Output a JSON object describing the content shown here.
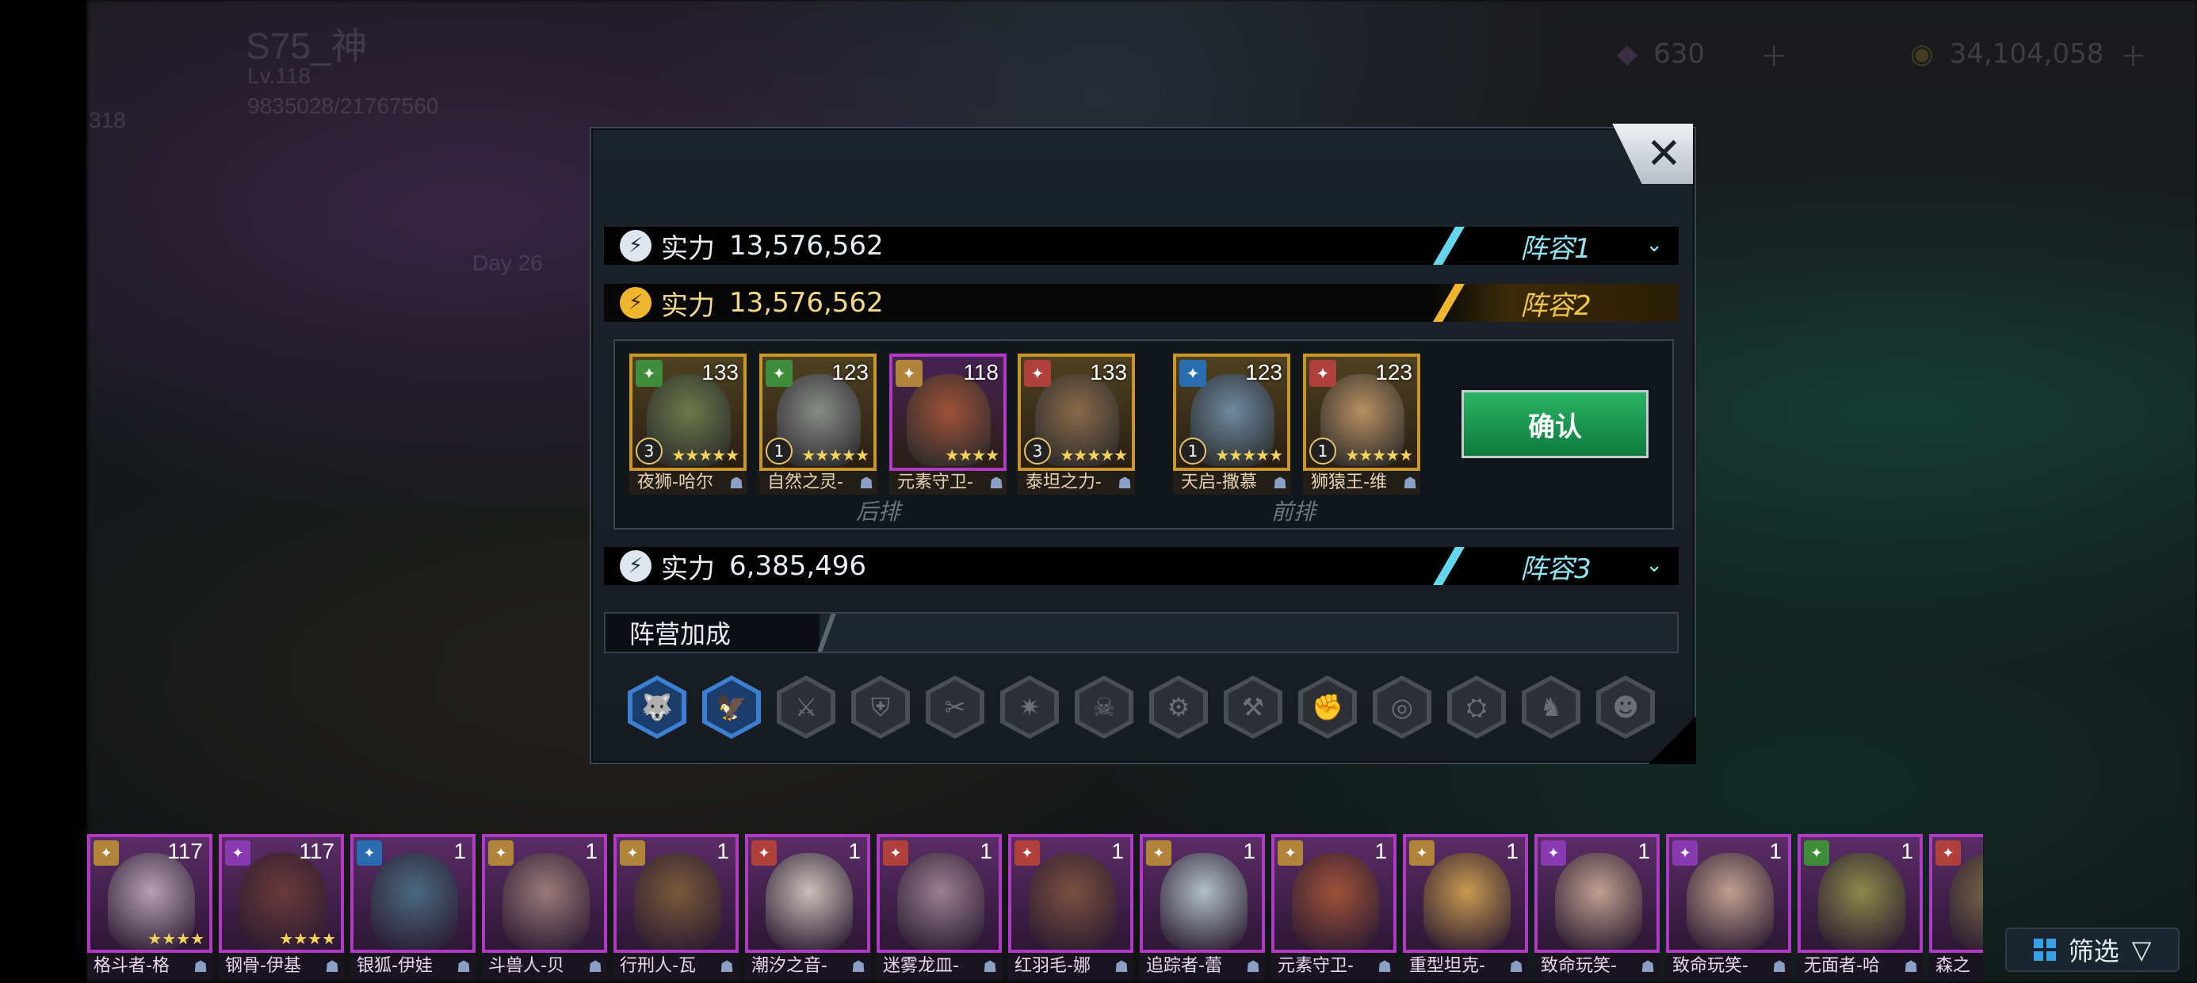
{
  "background": {
    "player_name": "S75_神",
    "level": "Lv.118",
    "exp": "9835028/21767560",
    "vip": "318",
    "day": "Day 26",
    "gems": "630",
    "gold": "34,104,058"
  },
  "dialog": {
    "close_label": "✕",
    "lineups": [
      {
        "power_label": "实力",
        "power": "13,576,562",
        "tag": "阵容1",
        "active": false
      },
      {
        "power_label": "实力",
        "power": "13,576,562",
        "tag": "阵容2",
        "active": true
      },
      {
        "power_label": "实力",
        "power": "6,385,496",
        "tag": "阵容3",
        "active": false
      }
    ],
    "confirm_label": "确认",
    "back_row_label": "后排",
    "front_row_label": "前排",
    "heroes": [
      {
        "name": "夜狮-哈尔",
        "level": "133",
        "badge": "3",
        "stars": "★★★★★",
        "faction_color": "#3f8c3a",
        "border": "#c8962a",
        "face": "#6e7a4a"
      },
      {
        "name": "自然之灵-",
        "level": "123",
        "badge": "1",
        "stars": "★★★★★",
        "faction_color": "#3f8c3a",
        "border": "#c8962a",
        "face": "#8a8c8a"
      },
      {
        "name": "元素守卫-",
        "level": "118",
        "badge": "",
        "stars": "★★★★",
        "faction_color": "#b0843b",
        "border": "#b03ac4",
        "face": "#a0523a"
      },
      {
        "name": "泰坦之力-",
        "level": "133",
        "badge": "3",
        "stars": "★★★★★",
        "faction_color": "#b0403b",
        "border": "#c8962a",
        "face": "#8a6a4a"
      },
      {
        "name": "天启-撒慕",
        "level": "123",
        "badge": "1",
        "stars": "★★★★★",
        "faction_color": "#2a6cb0",
        "border": "#c8962a",
        "face": "#6e8aa0"
      },
      {
        "name": "狮猿王-维",
        "level": "123",
        "badge": "1",
        "stars": "★★★★★",
        "faction_color": "#b0403b",
        "border": "#c8962a",
        "face": "#b89060"
      }
    ],
    "camp_bonus_label": "阵营加成",
    "camp_icons": [
      {
        "icon": "wolf-icon",
        "on": true
      },
      {
        "icon": "raven-icon",
        "on": true
      },
      {
        "icon": "claw-icon",
        "on": false
      },
      {
        "icon": "shield-icon",
        "on": false
      },
      {
        "icon": "blade-icon",
        "on": false
      },
      {
        "icon": "spike-icon",
        "on": false
      },
      {
        "icon": "skull-icon",
        "on": false
      },
      {
        "icon": "gear-icon",
        "on": false
      },
      {
        "icon": "axe-icon",
        "on": false
      },
      {
        "icon": "fist-icon",
        "on": false
      },
      {
        "icon": "spiral-icon",
        "on": false
      },
      {
        "icon": "mech-icon",
        "on": false
      },
      {
        "icon": "beast-icon",
        "on": false
      },
      {
        "icon": "mask-icon",
        "on": false
      }
    ]
  },
  "roster": [
    {
      "name": "格斗者-格",
      "level": "117",
      "stars": "★★★★",
      "faction_color": "#b0843b",
      "face": "#b7a0b8"
    },
    {
      "name": "钢骨-伊基",
      "level": "117",
      "stars": "★★★★",
      "faction_color": "#8a3ab0",
      "face": "#6a3a3a"
    },
    {
      "name": "银狐-伊娃",
      "level": "1",
      "stars": "",
      "faction_color": "#2a6cb0",
      "face": "#4a6a80"
    },
    {
      "name": "斗兽人-贝",
      "level": "1",
      "stars": "",
      "faction_color": "#b0843b",
      "face": "#9a7a7a"
    },
    {
      "name": "行刑人-瓦",
      "level": "1",
      "stars": "",
      "faction_color": "#b0843b",
      "face": "#7a5a3a"
    },
    {
      "name": "潮汐之音-",
      "level": "1",
      "stars": "",
      "faction_color": "#b0403b",
      "face": "#c8c0b8"
    },
    {
      "name": "迷雾龙皿-",
      "level": "1",
      "stars": "",
      "faction_color": "#b0403b",
      "face": "#9a8090"
    },
    {
      "name": "红羽毛-娜",
      "level": "1",
      "stars": "",
      "faction_color": "#b0403b",
      "face": "#7a5040"
    },
    {
      "name": "追踪者-蕾",
      "level": "1",
      "stars": "",
      "faction_color": "#b0843b",
      "face": "#b0c0c8"
    },
    {
      "name": "元素守卫-",
      "level": "1",
      "stars": "",
      "faction_color": "#b0843b",
      "face": "#a0523a"
    },
    {
      "name": "重型坦克-",
      "level": "1",
      "stars": "",
      "faction_color": "#b0843b",
      "face": "#c89a50"
    },
    {
      "name": "致命玩笑-",
      "level": "1",
      "stars": "",
      "faction_color": "#8a3ab0",
      "face": "#c0a090"
    },
    {
      "name": "致命玩笑-",
      "level": "1",
      "stars": "",
      "faction_color": "#8a3ab0",
      "face": "#c0a090"
    },
    {
      "name": "无面者-哈",
      "level": "1",
      "stars": "",
      "faction_color": "#3f8c3a",
      "face": "#8a8a4a"
    },
    {
      "name": "森之",
      "level": "",
      "stars": "",
      "faction_color": "#b0403b",
      "face": "#7a6a4a"
    }
  ],
  "filter_label": "筛选",
  "filter_arrow": "▽"
}
